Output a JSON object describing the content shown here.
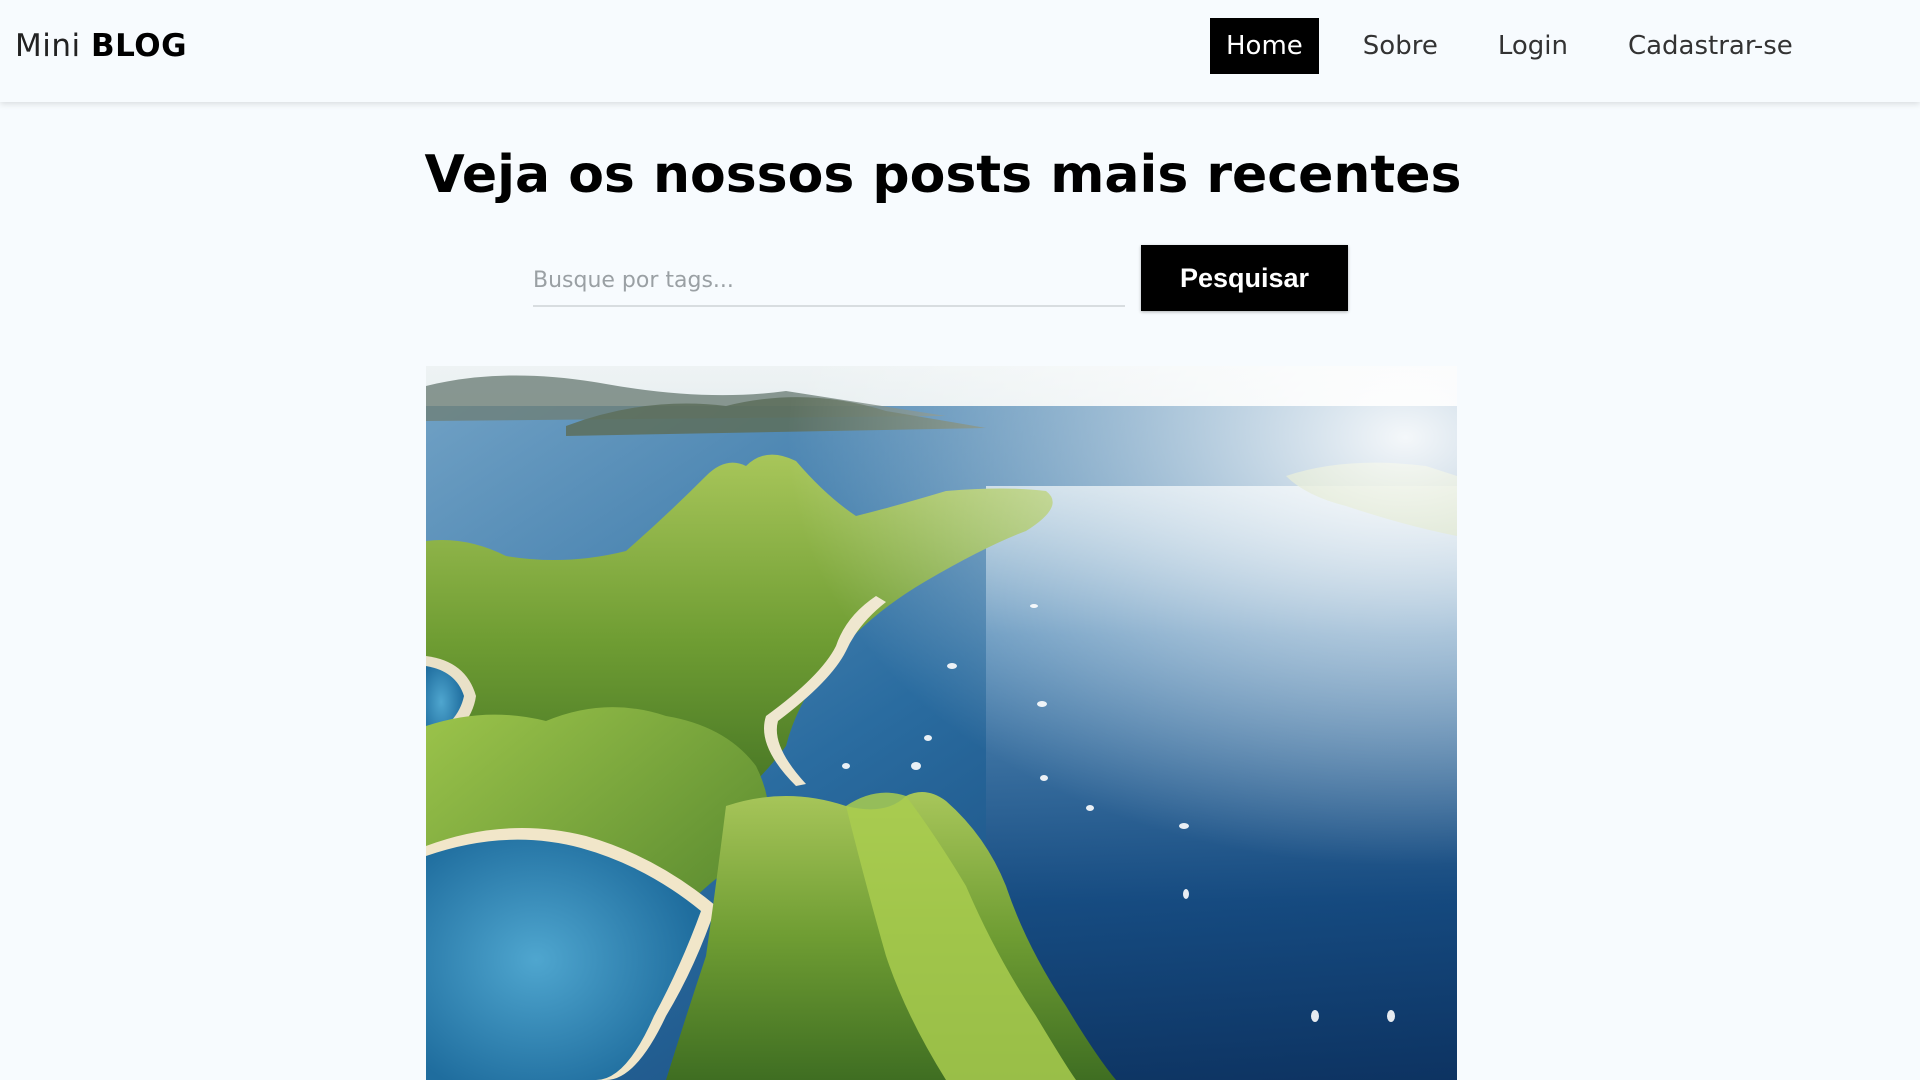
{
  "navbar": {
    "brand_light": "Mini",
    "brand_bold": "BLOG",
    "links": [
      {
        "label": "Home",
        "active": true
      },
      {
        "label": "Sobre",
        "active": false
      },
      {
        "label": "Login",
        "active": false
      },
      {
        "label": "Cadastrar-se",
        "active": false
      }
    ]
  },
  "main": {
    "title": "Veja os nossos posts mais recentes",
    "search": {
      "placeholder": "Busque por tags...",
      "value": "",
      "button_label": "Pesquisar"
    },
    "post_image": {
      "subject": "aerial view of green mountainous islands and blue bay with boats"
    }
  },
  "colors": {
    "background": "#f7fbfe",
    "accent": "#000000",
    "sea_deep": "#0e3a6a",
    "hills": "#7fb03a"
  }
}
